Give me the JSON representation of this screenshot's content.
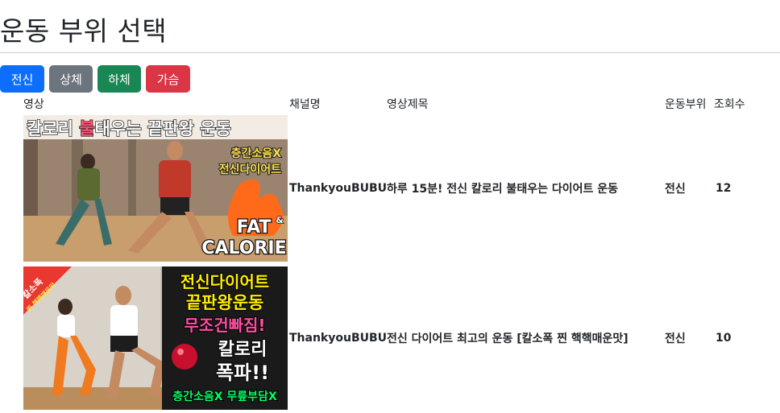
{
  "page": {
    "title": "운동 부위 선택"
  },
  "filters": {
    "all": "전신",
    "upper": "상체",
    "lower": "하체",
    "chest": "가슴"
  },
  "table": {
    "headers": {
      "video": "영상",
      "channel": "채널명",
      "title": "영상제목",
      "part": "운동부위",
      "views": "조회수"
    },
    "rows": [
      {
        "channel": "ThankyouBUBU",
        "title": "하루 15분! 전신 칼로리 불태우는 다이어트 운동",
        "part": "전신",
        "views": "12",
        "thumb": {
          "top_text_1": "칼로리 ",
          "top_text_hl": "불",
          "top_text_2": "태우는 끝판왕 운동",
          "side_1": "층간소음X",
          "side_2": "전신다이어트",
          "fat": "FAT",
          "amp": "&",
          "calorie": "CALORIE"
        }
      },
      {
        "channel": "ThankyouBUBU",
        "title": "전신 다이어트 최고의 운동 [칼소폭 찐 핵핵매운맛]",
        "part": "전신",
        "views": "10",
        "thumb": {
          "badge_1": "칼소폭",
          "badge_2": "찐 핵핵매운맛",
          "l1": "전신다이어트",
          "l2": "끝판왕운동",
          "l3": "무조건빠짐!",
          "l4": "칼로리",
          "l5": "폭파!!",
          "bottom": "층간소음X 무릎부담X"
        }
      }
    ]
  }
}
